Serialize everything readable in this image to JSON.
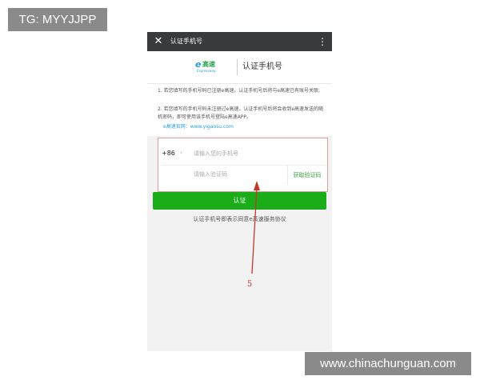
{
  "corner_badge": "TG: MYYJJPP",
  "watermark": "www.chinachunguan.com",
  "titlebar": {
    "close_glyph": "✕",
    "title": "认证手机号",
    "menu_glyph": "⋮"
  },
  "header": {
    "logo_mark": "e",
    "logo_name": "高速",
    "logo_sub": "Expressway",
    "title": "认证手机号"
  },
  "notes": {
    "item1": "1. 若您填写的手机号码已注册e高速，认证手机号后将与e高速已有账号关联;",
    "item2": "2. 若您填写的手机号码未注册过e高速，认证手机号后将会收到e高速发送的随机密码，即可使用该手机号登陆e高速APP。",
    "site": "e高速官网：www.yigaosu.com"
  },
  "form": {
    "country_code": "+86",
    "chevron": "›",
    "phone_placeholder": "请输入您的手机号",
    "code_placeholder": "请输入验证码",
    "get_code_label": "获取验证码"
  },
  "submit_label": "认证",
  "agreement": "认证手机号即表示同意e高速服务协议",
  "annotation": {
    "label": "5",
    "color": "#c0392b"
  },
  "colors": {
    "accent_green": "#1aad19",
    "titlebar_bg": "#393a3e",
    "link_blue": "#2a9fd6"
  }
}
